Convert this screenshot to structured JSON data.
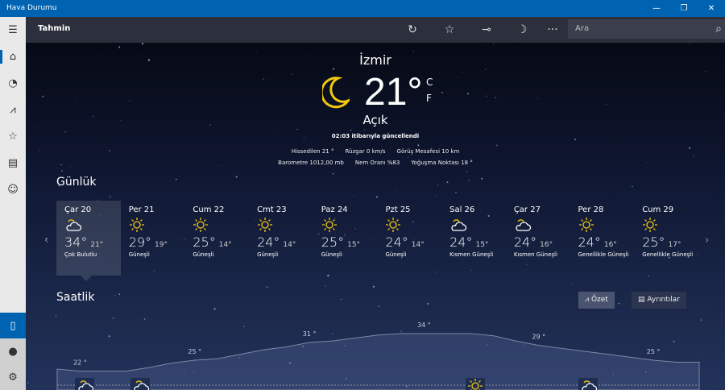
{
  "window": {
    "title": "Hava Durumu",
    "minimize": "—",
    "maximize": "❐",
    "close": "✕"
  },
  "header": {
    "title": "Tahmin",
    "search_placeholder": "Ara",
    "more": "···"
  },
  "sidebar": {
    "items": [
      "menu-icon",
      "home-icon",
      "forecast-maps-icon",
      "historical-icon",
      "favorites-icon",
      "news-icon",
      "feedback-icon"
    ],
    "bottom": [
      "phone-icon",
      "account-icon",
      "settings-icon"
    ]
  },
  "current": {
    "city": "İzmir",
    "temp": "21°",
    "unit_c": "C",
    "unit_f": "F",
    "condition": "Açık",
    "updated": "02:03 itibarıyla güncellendi",
    "details_row1": [
      "Hissedilen  21 °",
      "Rüzgar   0 km/s",
      "Görüş Mesafesi   10 km"
    ],
    "details_row2": [
      "Barometre   1012,00 mb",
      "Nem Oranı   %83",
      "Yoğuşma Noktası   18 °"
    ]
  },
  "daily": {
    "title": "Günlük",
    "days": [
      {
        "name": "Çar 20",
        "hi": "34°",
        "lo": "21°",
        "text": "Çok Bulutlu",
        "icon": "cloud"
      },
      {
        "name": "Per 21",
        "hi": "29°",
        "lo": "19°",
        "text": "Güneşli",
        "icon": "sun"
      },
      {
        "name": "Cum 22",
        "hi": "25°",
        "lo": "14°",
        "text": "Güneşli",
        "icon": "sun"
      },
      {
        "name": "Cmt 23",
        "hi": "24°",
        "lo": "14°",
        "text": "Güneşli",
        "icon": "sun"
      },
      {
        "name": "Paz 24",
        "hi": "25°",
        "lo": "15°",
        "text": "Güneşli",
        "icon": "sun"
      },
      {
        "name": "Pzt 25",
        "hi": "24°",
        "lo": "14°",
        "text": "Güneşli",
        "icon": "sun"
      },
      {
        "name": "Sal 26",
        "hi": "24°",
        "lo": "15°",
        "text": "Kısmen Güneşli",
        "icon": "partly"
      },
      {
        "name": "Çar 27",
        "hi": "24°",
        "lo": "16°",
        "text": "Kısmen Güneşli",
        "icon": "partly"
      },
      {
        "name": "Per 28",
        "hi": "24°",
        "lo": "16°",
        "text": "Genellikle Güneşli",
        "icon": "sun"
      },
      {
        "name": "Cum 29",
        "hi": "25°",
        "lo": "17°",
        "text": "Genellikle Güneşli",
        "icon": "sun"
      }
    ]
  },
  "hourly": {
    "title": "Saatlik",
    "summary_label": "Özet",
    "details_label": "Ayrıntılar",
    "temps": [
      22,
      21.3,
      21.3,
      21.3,
      22.5,
      24,
      25,
      25.5,
      27,
      28.5,
      29.5,
      31,
      31.5,
      32.5,
      33.5,
      34,
      34,
      34,
      34,
      33.3,
      31.5,
      30,
      29,
      28,
      27,
      26,
      25,
      24.3,
      24.3
    ],
    "labels": [
      {
        "i": 1,
        "text": "22 °"
      },
      {
        "i": 6,
        "text": "25 °"
      },
      {
        "i": 11,
        "text": "31 °"
      },
      {
        "i": 16,
        "text": "34 °"
      },
      {
        "i": 21,
        "text": "29 °"
      },
      {
        "i": 26,
        "text": "25 °"
      }
    ]
  },
  "colors": {
    "accent": "#0063b1",
    "sun": "#f2c811"
  }
}
